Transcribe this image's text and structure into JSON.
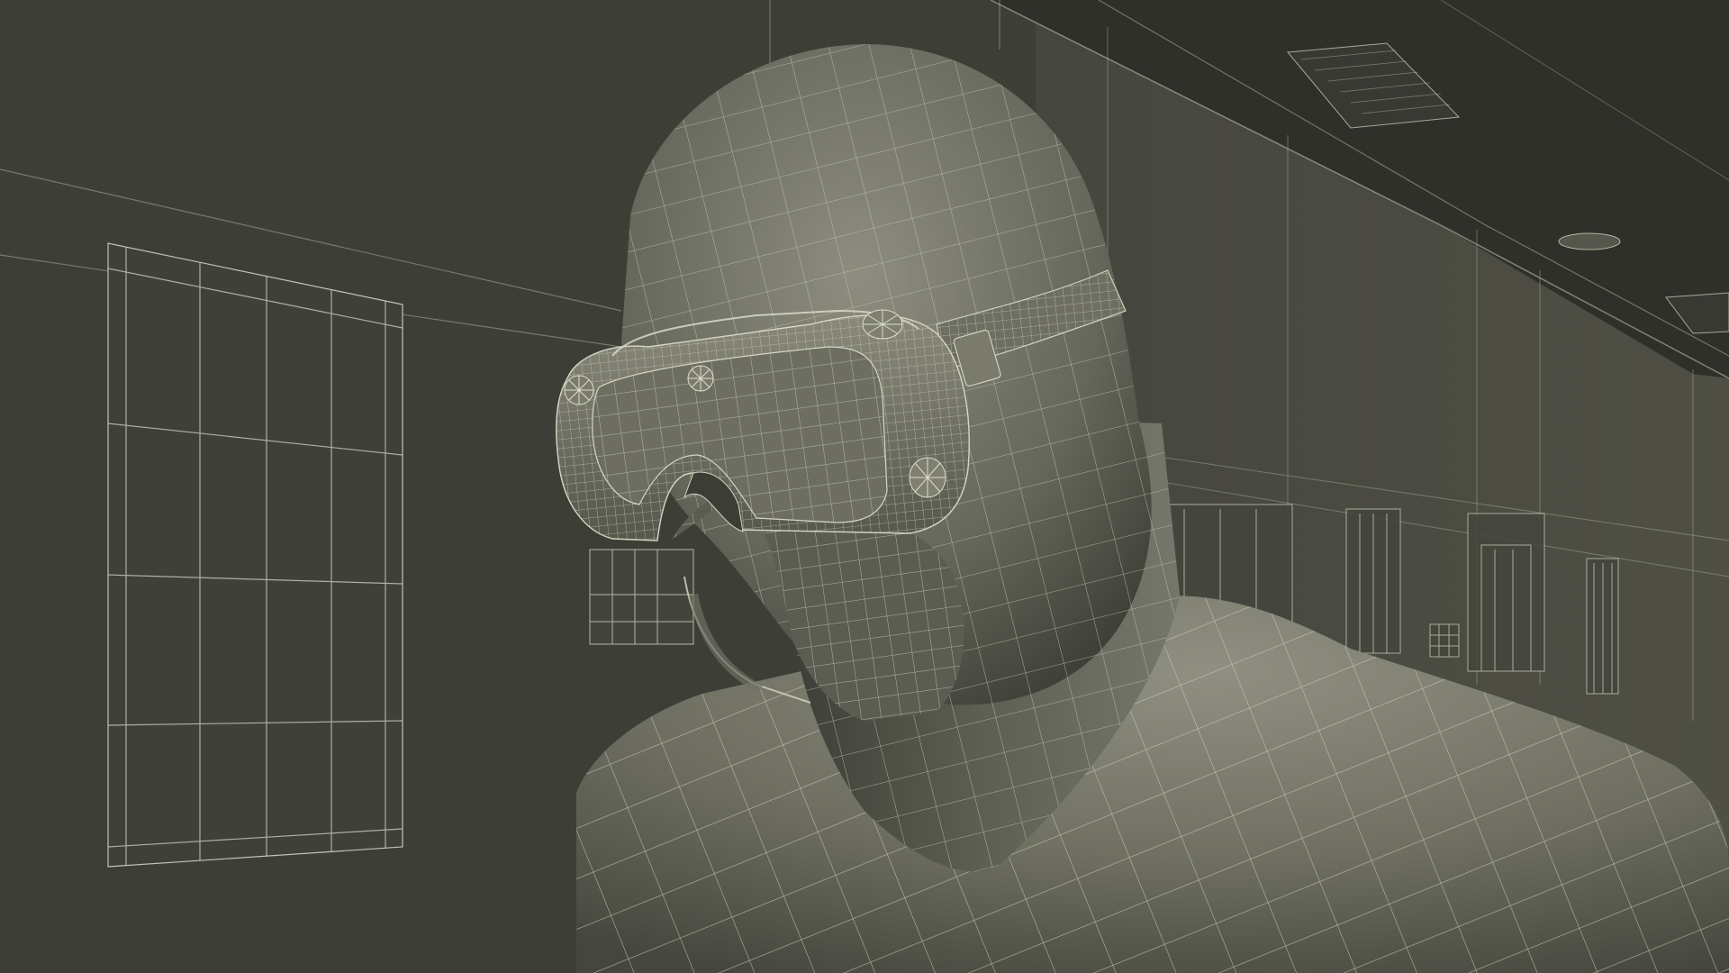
{
  "scene": {
    "subject_icon": "wireframe-figure-icon",
    "palette": {
      "wall_far": "#4a4a41",
      "wall_left": "#3e3f37",
      "ceiling": "#2e2f29",
      "skin_light": "#8a8a7c",
      "skin_mid": "#6b6b5e",
      "skin_dark": "#3d3e36",
      "wire": "#c9c9b6",
      "goggle_frame": "#7d7d6f"
    }
  }
}
